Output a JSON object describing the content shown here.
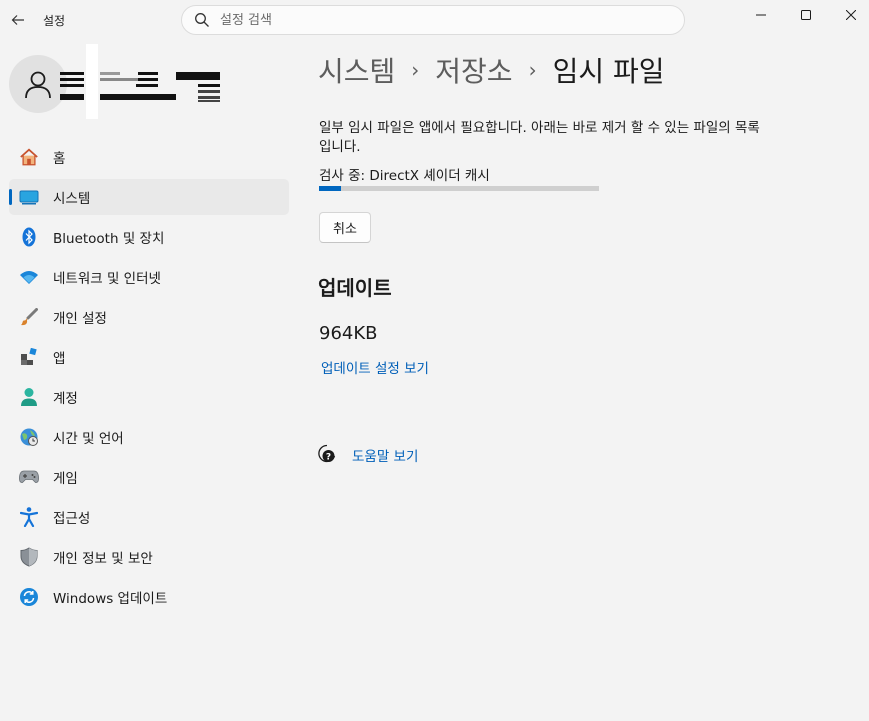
{
  "window": {
    "title": "설정",
    "controls": {
      "minimize": "minimize-icon",
      "maximize": "maximize-icon",
      "close": "close-icon"
    }
  },
  "search": {
    "placeholder": "설정 검색"
  },
  "profile": {
    "avatar_icon": "person-icon"
  },
  "sidebar": {
    "items": [
      {
        "label": "홈",
        "icon": "home-icon"
      },
      {
        "label": "시스템",
        "icon": "system-icon",
        "selected": true
      },
      {
        "label": "Bluetooth 및 장치",
        "icon": "bluetooth-icon"
      },
      {
        "label": "네트워크 및 인터넷",
        "icon": "wifi-icon"
      },
      {
        "label": "개인 설정",
        "icon": "brush-icon"
      },
      {
        "label": "앱",
        "icon": "apps-icon"
      },
      {
        "label": "계정",
        "icon": "account-icon"
      },
      {
        "label": "시간 및 언어",
        "icon": "time-language-icon"
      },
      {
        "label": "게임",
        "icon": "gamepad-icon"
      },
      {
        "label": "접근성",
        "icon": "accessibility-icon"
      },
      {
        "label": "개인 정보 및 보안",
        "icon": "shield-icon"
      },
      {
        "label": "Windows 업데이트",
        "icon": "update-icon"
      }
    ]
  },
  "breadcrumb": {
    "items": [
      "시스템",
      "저장소"
    ],
    "current": "임시 파일"
  },
  "main": {
    "description": "일부 임시 파일은 앱에서 필요합니다. 아래는 바로 제거 할 수 있는 파일의 목록입니다.",
    "scan_status": "검사 중: DirectX 셰이더 캐시",
    "progress_fraction": 0.08,
    "cancel_label": "취소",
    "section_title": "업데이트",
    "size_value": "964KB",
    "update_settings_link": "업데이트 설정 보기",
    "help_link": "도움말 보기"
  },
  "colors": {
    "accent": "#0067c0",
    "link": "#005fb8",
    "background": "#f3f3f3"
  }
}
